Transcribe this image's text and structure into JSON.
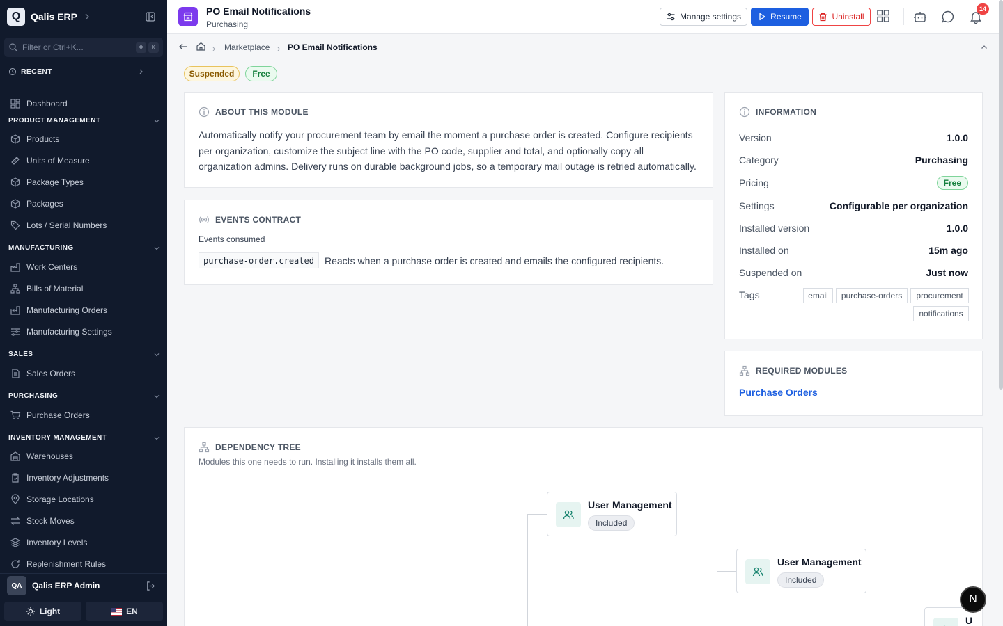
{
  "app": {
    "name": "Qalis ERP",
    "logo_letter": "Q"
  },
  "sidebar": {
    "search_placeholder": "Filter or Ctrl+K...",
    "shortcut_keys": [
      "⌘",
      "K"
    ],
    "recent_label": "RECENT",
    "dashboard": "Dashboard",
    "sections": [
      {
        "title": "PRODUCT MANAGEMENT",
        "items": [
          "Products",
          "Units of Measure",
          "Package Types",
          "Packages",
          "Lots / Serial Numbers"
        ]
      },
      {
        "title": "MANUFACTURING",
        "items": [
          "Work Centers",
          "Bills of Material",
          "Manufacturing Orders",
          "Manufacturing Settings"
        ]
      },
      {
        "title": "SALES",
        "items": [
          "Sales Orders"
        ]
      },
      {
        "title": "PURCHASING",
        "items": [
          "Purchase Orders"
        ]
      },
      {
        "title": "INVENTORY MANAGEMENT",
        "items": [
          "Warehouses",
          "Inventory Adjustments",
          "Storage Locations",
          "Stock Moves",
          "Inventory Levels",
          "Replenishment Rules"
        ]
      }
    ],
    "user": {
      "initials": "QA",
      "name": "Qalis ERP Admin"
    },
    "theme_label": "Light",
    "lang_label": "EN"
  },
  "header": {
    "title": "PO Email Notifications",
    "subtitle": "Purchasing",
    "manage_label": "Manage settings",
    "resume_label": "Resume",
    "uninstall_label": "Uninstall",
    "notif_count": "14"
  },
  "breadcrumb": {
    "items": [
      "Marketplace",
      "PO Email Notifications"
    ]
  },
  "badges": {
    "status": "Suspended",
    "pricing": "Free"
  },
  "about": {
    "heading": "ABOUT THIS MODULE",
    "text": "Automatically notify your procurement team by email the moment a purchase order is created. Configure recipients per organization, customize the subject line with the PO code, supplier and total, and optionally copy all organization admins. Delivery runs on durable background jobs, so a temporary mail outage is retried automatically."
  },
  "events": {
    "heading": "EVENTS CONTRACT",
    "consumed_label": "Events consumed",
    "event_code": "purchase-order.created",
    "event_desc": "Reacts when a purchase order is created and emails the configured recipients."
  },
  "information": {
    "heading": "INFORMATION",
    "rows": [
      {
        "k": "Version",
        "v": "1.0.0"
      },
      {
        "k": "Category",
        "v": "Purchasing"
      },
      {
        "k": "Pricing",
        "v": "Free"
      },
      {
        "k": "Settings",
        "v": "Configurable per organization"
      },
      {
        "k": "Installed version",
        "v": "1.0.0"
      },
      {
        "k": "Installed on",
        "v": "15m ago"
      },
      {
        "k": "Suspended on",
        "v": "Just now"
      },
      {
        "k": "Tags",
        "v": ""
      }
    ],
    "tags": [
      "email",
      "purchase-orders",
      "procurement",
      "notifications"
    ]
  },
  "required": {
    "heading": "REQUIRED MODULES",
    "modules": [
      "Purchase Orders"
    ]
  },
  "dependency": {
    "heading": "DEPENDENCY TREE",
    "subtitle": "Modules this one needs to run. Installing it installs them all.",
    "nodes": [
      {
        "name": "User Management",
        "status": "Included"
      },
      {
        "name": "User Management",
        "status": "Included"
      },
      {
        "name": "U",
        "status": ""
      }
    ]
  },
  "floating_button": "N",
  "colors": {
    "sidebar_bg": "#111a2c",
    "primary": "#1d5fe0",
    "danger": "#dc2626",
    "module_icon": "#7c3aed",
    "success": "#15803d",
    "warning": "#8a5a00"
  }
}
